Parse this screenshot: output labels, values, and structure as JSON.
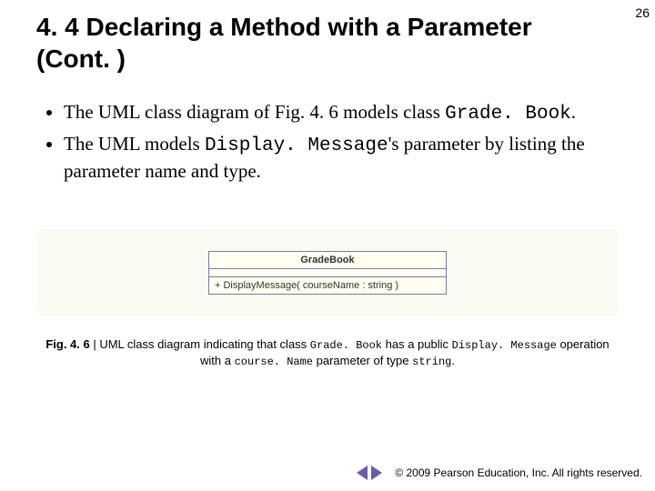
{
  "page_number": "26",
  "title": "4. 4  Declaring a Method with a Parameter (Cont. )",
  "bullets": [
    {
      "pre": "The UML class diagram of Fig. 4. 6 models class ",
      "code": "Grade. Book",
      "post": "."
    },
    {
      "pre": "The UML models ",
      "code": "Display. Message",
      "post": "'s parameter by listing the parameter name and type."
    }
  ],
  "uml": {
    "class_name": "GradeBook",
    "operation": "+ DisplayMessage( courseName : string )"
  },
  "caption": {
    "label": "Fig. 4. 6",
    "sep": " | ",
    "t1": "UML class diagram indicating that class ",
    "c1": "Grade. Book",
    "t2": " has a public ",
    "c2": "Display. Message",
    "t3": " operation with a ",
    "c3": "course. Name",
    "t4": " parameter of type ",
    "c4": "string",
    "t5": "."
  },
  "footer": {
    "copyright": "© 2009 Pearson Education, Inc.  All rights reserved."
  }
}
